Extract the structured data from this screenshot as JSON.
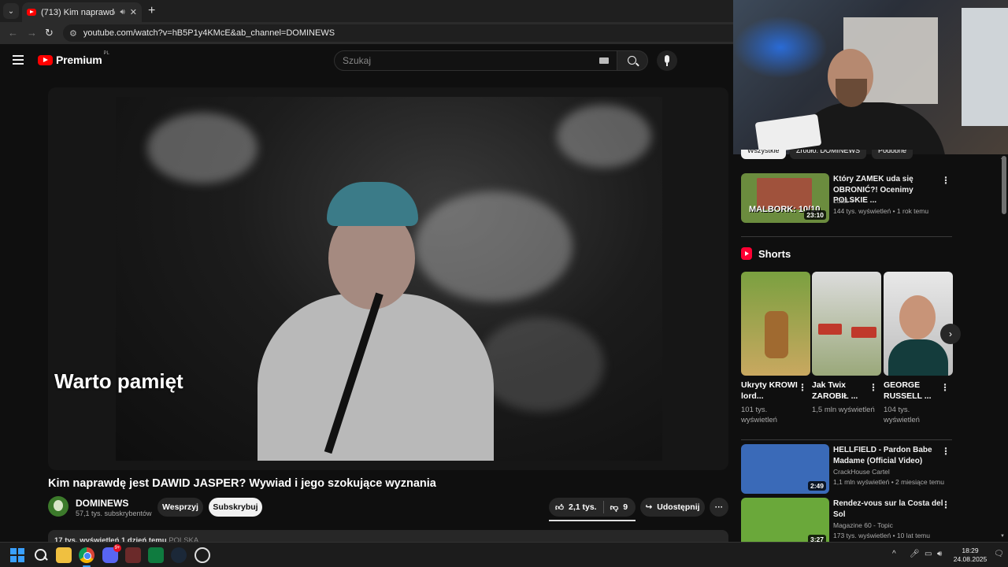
{
  "browser": {
    "tab_title": "(713) Kim naprawdę jest DAWID JASPER? Wywiad i jego szokujące wyznania",
    "new_tab": "+",
    "url": "youtube.com/watch?v=hB5P1y4KMcE&ab_channel=DOMINEWS"
  },
  "header": {
    "logo_text": "Premium",
    "logo_country": "PL",
    "search_placeholder": "Szukaj"
  },
  "video": {
    "caption": "Warto pamięt",
    "title": "Kim naprawdę jest DAWID JASPER? Wywiad i jego szokujące wyznania",
    "channel": "DOMINEWS",
    "subscribers": "57,1 tys. subskrybentów",
    "support_label": "Wesprzyj",
    "subscribe_label": "Subskrybuj",
    "likes": "2,1 tys.",
    "dislikes": "9",
    "share_label": "Udostępnij",
    "more_label": "···",
    "description_stats": "17 tys. wyświetleń  1 dzień temu",
    "description_tag": "POLSKA"
  },
  "sidebar": {
    "chips": [
      "Wszystkie",
      "Źródło: DOMINEWS",
      "Podobne"
    ],
    "recommended": [
      {
        "title": "Który ZAMEK uda się OBRONIĆ?! Ocenimy POLSKIE ...",
        "channel": "Lutel",
        "meta": "144 tys. wyświetleń • 1 rok temu",
        "duration": "23:10",
        "thumb_text": "MALBORK: 10/10",
        "thumb_color": "#6b8c3e"
      }
    ],
    "shorts_label": "Shorts",
    "shorts": [
      {
        "title": "Ukryty KROWI lord...",
        "views": "101 tys. wyświetleń",
        "thumb_color": "#8a7a3a"
      },
      {
        "title": "Jak Twix ZAROBIŁ ...",
        "views": "1,5 mln wyświetleń",
        "thumb_color": "#9aa87a"
      },
      {
        "title": "GEORGE RUSSELL ...",
        "views": "104 tys. wyświetleń",
        "thumb_color": "#2a6a6a"
      }
    ],
    "more_videos": [
      {
        "title": "HELLFIELD - Pardon Babe Madame (Official Video)",
        "channel": "CrackHouse Cartel",
        "meta": "1,1 mln wyświetleń • 2 miesiące temu",
        "duration": "2:49",
        "thumb_color": "#3a6ab8"
      },
      {
        "title": "Rendez-vous sur la Costa del Sol",
        "channel": "Magazine 60 - Topic",
        "meta": "173 tys. wyświetleń • 10 lat temu",
        "duration": "3:27",
        "thumb_color": "#6aa83a"
      }
    ]
  },
  "taskbar": {
    "discord_badge": "9+",
    "time": "18:29",
    "date": "24.08.2025"
  }
}
